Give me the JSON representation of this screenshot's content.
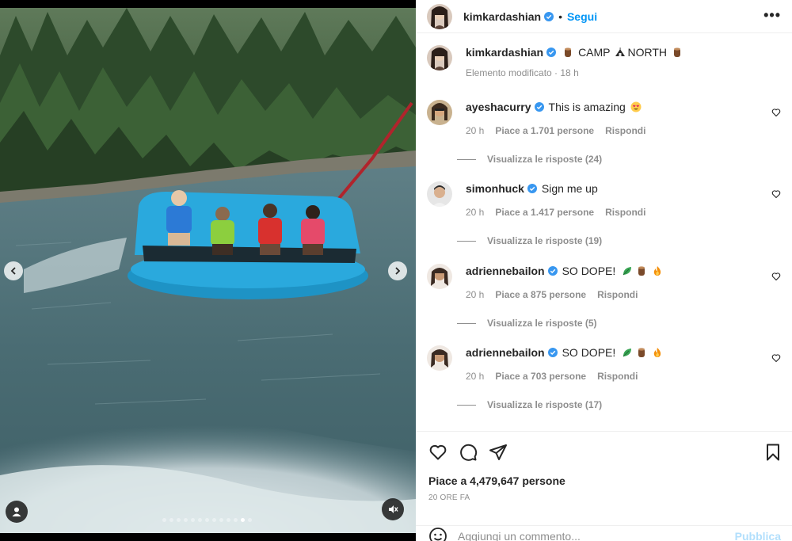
{
  "post": {
    "author": "kimkardashian",
    "follow_label": "Segui",
    "separator": "•",
    "more_label": "•••"
  },
  "caption": {
    "username": "kimkardashian",
    "text_part1": "CAMP",
    "text_part2": "NORTH",
    "meta": "Elemento modificato · 18 h"
  },
  "comments": [
    {
      "username": "ayeshacurry",
      "text": "This is amazing",
      "time": "20 h",
      "likes": "Piace a 1.701 persone",
      "reply": "Rispondi",
      "view_replies": "Visualizza le risposte (24)",
      "emojis": [
        "heart-eyes"
      ]
    },
    {
      "username": "simonhuck",
      "text": "Sign me up",
      "time": "20 h",
      "likes": "Piace a 1.417 persone",
      "reply": "Rispondi",
      "view_replies": "Visualizza le risposte (19)",
      "emojis": []
    },
    {
      "username": "adriennebailon",
      "text": "SO DOPE!",
      "time": "20 h",
      "likes": "Piace a 875 persone",
      "reply": "Rispondi",
      "view_replies": "Visualizza le risposte (5)",
      "emojis": [
        "leaf",
        "log",
        "fire"
      ]
    },
    {
      "username": "adriennebailon",
      "text": "SO DOPE!",
      "time": "20 h",
      "likes": "Piace a 703 persone",
      "reply": "Rispondi",
      "view_replies": "Visualizza le risposte (17)",
      "emojis": [
        "leaf",
        "log",
        "fire"
      ]
    }
  ],
  "engagement": {
    "likes": "Piace a 4,479,647 persone",
    "time_ago": "20 ORE FA"
  },
  "add_comment": {
    "placeholder": "Aggiungi un commento...",
    "publish_label": "Pubblica"
  },
  "colors": {
    "accent": "#0095f6",
    "verified": "#3897f0",
    "muted_text": "#8e8e8e",
    "publish_disabled": "#b2dffc"
  },
  "icons": [
    "chevron-left-icon",
    "chevron-right-icon",
    "user-tag-icon",
    "mute-icon",
    "heart-icon",
    "comment-icon",
    "share-icon",
    "bookmark-icon",
    "emoji-icon",
    "verified-icon",
    "more-icon"
  ]
}
